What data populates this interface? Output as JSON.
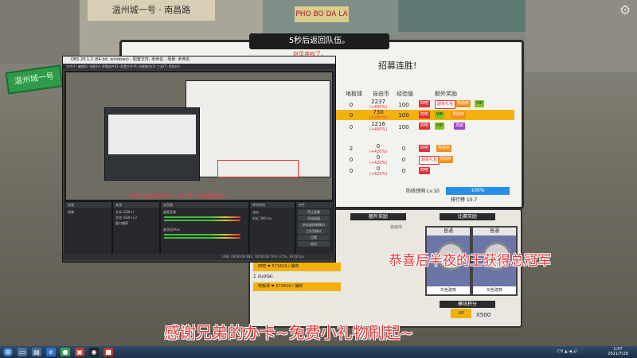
{
  "game": {
    "countdown": "5秒后返回队伍。",
    "victory": "招募连胜!",
    "red_note": "封页弃权了。",
    "left_sign": "温州城一号",
    "top_sign": "PHO BO DA LA",
    "top_sign2": "温州城一号 · 南昌路",
    "headers": [
      "地板球",
      "自由币",
      "经验值",
      "额外奖励"
    ],
    "rows": [
      {
        "a": "0",
        "b": "2237",
        "b_sub": "(+400%)",
        "c": "100",
        "highlight": false
      },
      {
        "a": "0",
        "b": "730",
        "b_sub": "(+200%)",
        "c": "100",
        "highlight": true
      },
      {
        "a": "0",
        "b": "1216",
        "b_sub": "(+400%)",
        "c": "100",
        "highlight": false
      },
      {
        "a": "2",
        "b": "0",
        "b_sub": "(+420%)",
        "c": "0",
        "highlight": false
      },
      {
        "a": "0",
        "b": "0",
        "b_sub": "(+420%)",
        "c": "0",
        "highlight": false
      },
      {
        "a": "0",
        "b": "0",
        "b_sub": "(+420%)",
        "c": "0",
        "highlight": false
      }
    ],
    "badges": {
      "red": "四吧",
      "white": "超级礼包",
      "orange": "赞助商",
      "green": "VIP",
      "purple": "高级"
    },
    "level_label": "防线铁网 Lv.10",
    "progress_text": "100%",
    "progress": 1.0,
    "rank_label": "排行榜 10.7"
  },
  "lower": {
    "extra_title": "额外奖励",
    "match_title": "比赛奖励",
    "free_coin": "自由币",
    "card_top": "普通",
    "card_bottom": "灰色建筑",
    "points_title": "模块积分",
    "points_value": "X500",
    "ybar1": "四吧 ❤ 573419 / 骗你",
    "ybar2": "1 zuotai.",
    "ybar3": "地板球 ❤ 573419 / 骗你"
  },
  "obs": {
    "title": "OBS 26.1.2 (64-bit, windows) - 配置文件: 未命名 - 场景: 未命名",
    "menu": "文件(F)  编辑(E)  视图(V)  停靠部件(D)  配置文件(P)  场景集合(S)  工具(T)  帮助(H)",
    "caption": "感谢兄弟的办卡~免费小礼物刷起~",
    "docks": [
      {
        "title": "场景",
        "items": [
          "场景"
        ]
      },
      {
        "title": "来源",
        "items": [
          "文本 (GDI+)",
          "文本 (GDI+) 2",
          "窗口捕获"
        ]
      },
      {
        "title": "混音器",
        "items": [
          "桌面音频",
          "麦克风/Aux"
        ]
      },
      {
        "title": "转场特效",
        "items": [
          "淡出",
          "时长 300 ms"
        ]
      },
      {
        "title": "控件",
        "items": [
          "停止直播",
          "开始录制",
          "启动虚拟摄像机",
          "工作室模式",
          "设置",
          "退出"
        ]
      }
    ],
    "status": "LIVE: 00:00:00   REC: 00:00:00   CPU: 3.5%, 30.00 fps"
  },
  "overlay": {
    "congrats": "恭喜后半夜的王获得总冠军",
    "thanks": "感谢兄弟的办卡~免费小礼物刷起~"
  },
  "taskbar": {
    "tray": "CH ▲ ◀ 🔊",
    "time": "1:57",
    "date": "2021/7/28"
  },
  "icons": [
    "start-orb-icon",
    "explorer-icon",
    "media-icon",
    "browser-icon",
    "app-icon",
    "obs-icon",
    "app2-icon",
    "app3-icon",
    "gear-icon",
    "coin-icon"
  ]
}
